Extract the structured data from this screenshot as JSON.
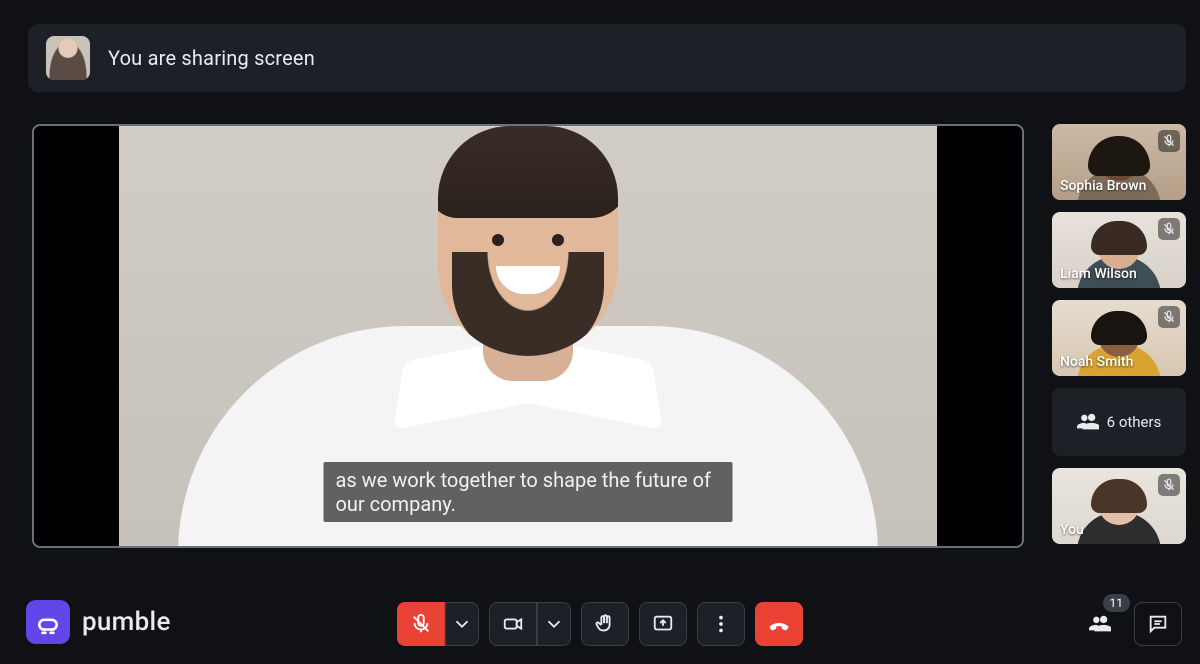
{
  "banner": {
    "text": "You are sharing screen"
  },
  "main": {
    "caption": "as we work together to shape the future of our company."
  },
  "participants": [
    {
      "name": "Sophia Brown",
      "muted": true
    },
    {
      "name": "Liam Wilson",
      "muted": true
    },
    {
      "name": "Noah Smith",
      "muted": true
    }
  ],
  "others_label": "6 others",
  "self_tile": {
    "name": "You",
    "muted": true
  },
  "brand": {
    "name": "pumble"
  },
  "people_count": "11",
  "colors": {
    "accent_red": "#ea4335",
    "brand_purple": "#6246ea",
    "bg": "#0f1115",
    "panel": "#1d2026"
  },
  "icons": {
    "mic_muted": "mic-muted-icon",
    "camera": "camera-icon",
    "hand": "raise-hand-icon",
    "present": "present-icon",
    "more": "more-icon",
    "hangup": "hangup-icon",
    "people": "people-icon",
    "chat": "chat-icon",
    "chevron_down": "chevron-down-icon"
  }
}
